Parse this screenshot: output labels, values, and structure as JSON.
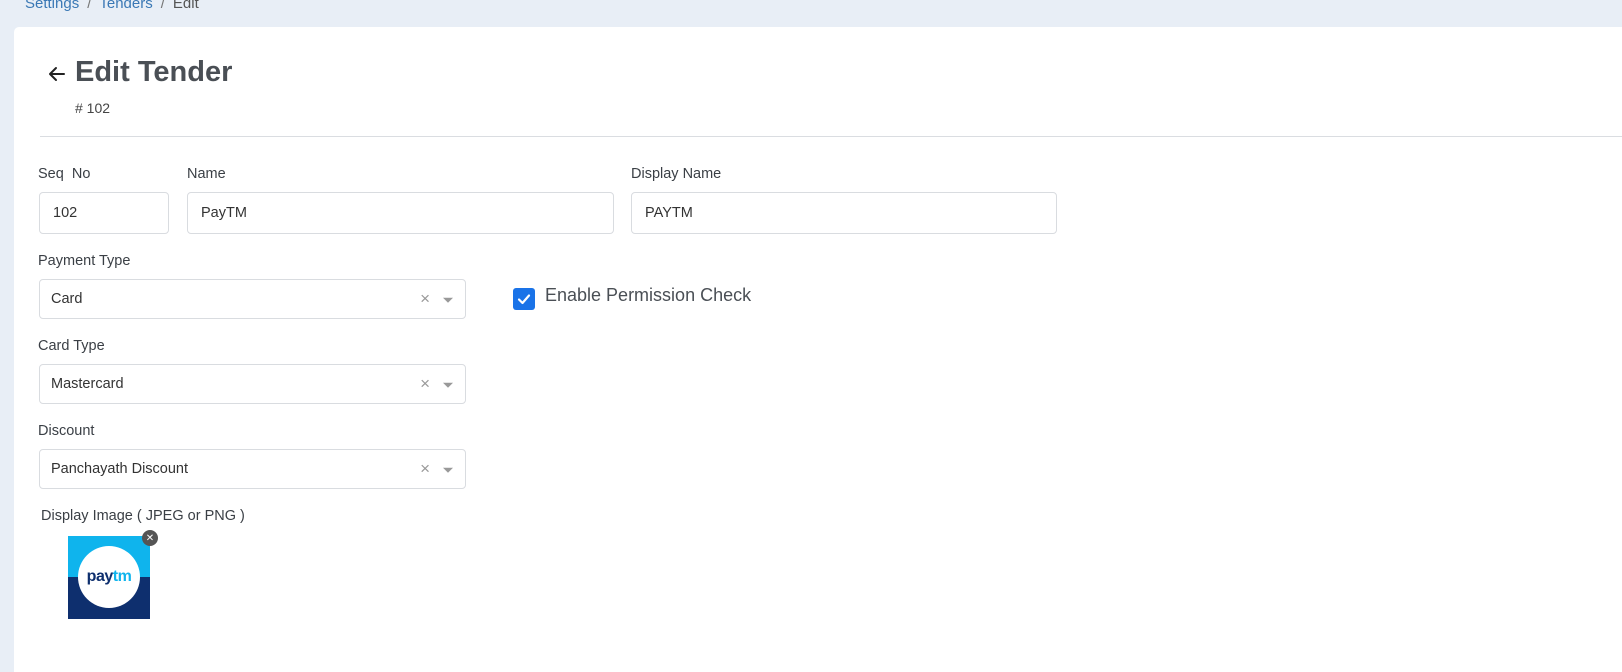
{
  "breadcrumb": {
    "items": [
      {
        "label": "Settings"
      },
      {
        "label": "Tenders"
      },
      {
        "label": "Edit"
      }
    ],
    "separator": "/"
  },
  "header": {
    "title": "Edit Tender",
    "subtitle": "# 102"
  },
  "form": {
    "seq_no": {
      "label": "Seq  No",
      "value": "102"
    },
    "name": {
      "label": "Name",
      "value": "PayTM"
    },
    "display_name": {
      "label": "Display Name",
      "value": "PAYTM"
    },
    "payment_type": {
      "label": "Payment Type",
      "value": "Card"
    },
    "card_type": {
      "label": "Card Type",
      "value": "Mastercard"
    },
    "discount": {
      "label": "Discount",
      "value": "Panchayath Discount"
    },
    "permission_check": {
      "label": "Enable Permission Check",
      "checked": true
    },
    "display_image": {
      "label": "Display Image ( JPEG or PNG )",
      "logo_pay": "pay",
      "logo_tm": "tm"
    }
  },
  "colors": {
    "accent": "#1a73e8",
    "link": "#3a78b5",
    "paytm_light": "#0fb4ed",
    "paytm_dark": "#0e2f6e"
  },
  "icons": {
    "back": "arrow-left-icon",
    "clear": "close-icon",
    "caret": "caret-down-icon",
    "check": "checkmark-icon"
  }
}
